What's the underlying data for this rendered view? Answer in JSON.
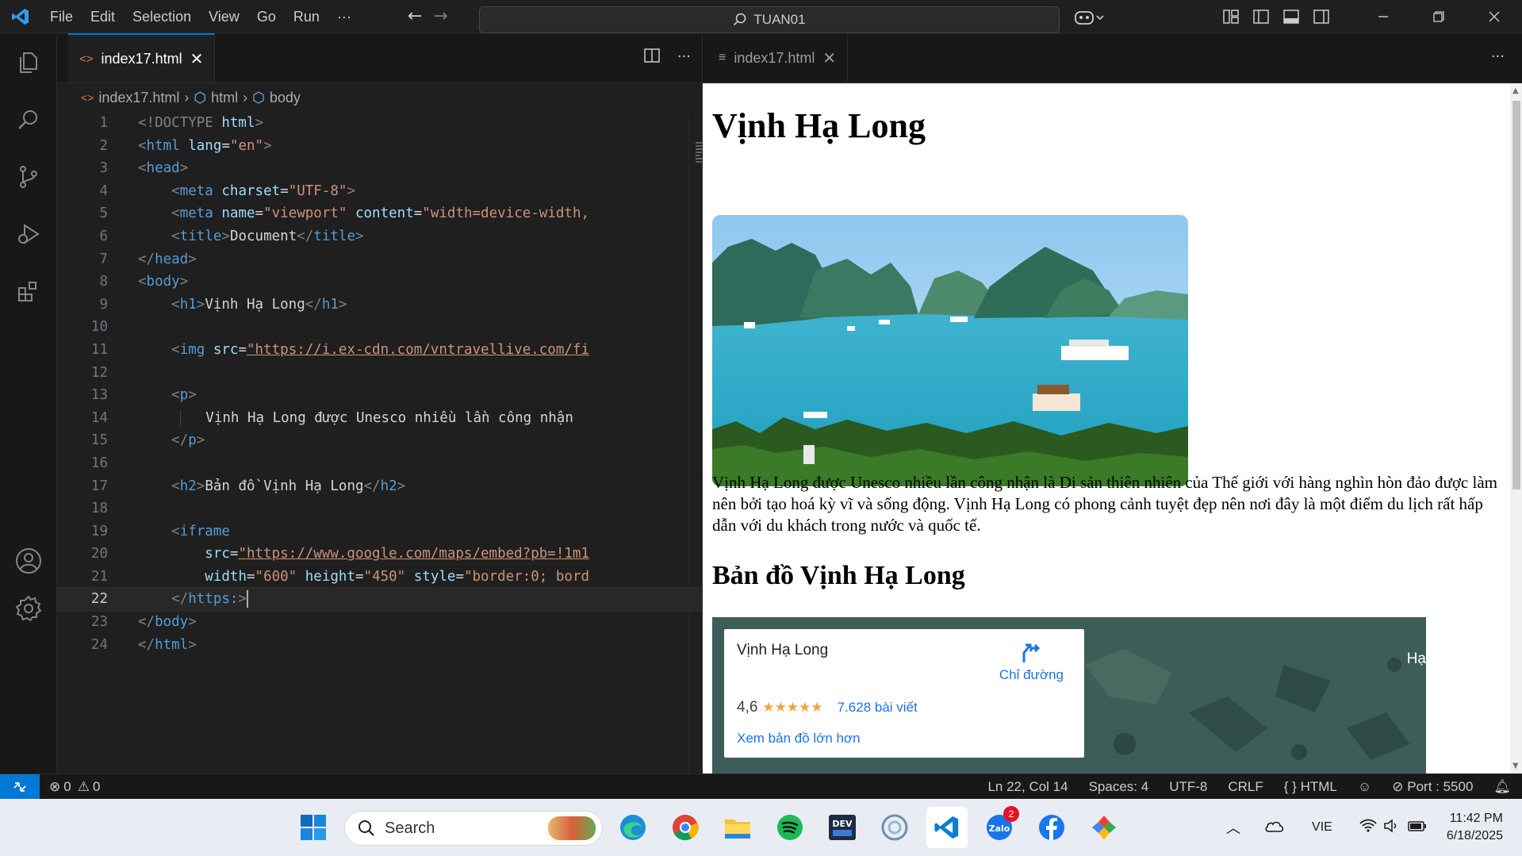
{
  "menu": [
    "File",
    "Edit",
    "Selection",
    "View",
    "Go",
    "Run",
    "···"
  ],
  "search": {
    "text": "TUAN01"
  },
  "editor": {
    "tab_label": "index17.html",
    "breadcrumb": [
      "index17.html",
      "html",
      "body"
    ]
  },
  "code_lines": [
    {
      "n": "1"
    },
    {
      "n": "2"
    },
    {
      "n": "3"
    },
    {
      "n": "4"
    },
    {
      "n": "5"
    },
    {
      "n": "6"
    },
    {
      "n": "7"
    },
    {
      "n": "8"
    },
    {
      "n": "9"
    },
    {
      "n": "10"
    },
    {
      "n": "11"
    },
    {
      "n": "12"
    },
    {
      "n": "13"
    },
    {
      "n": "14"
    },
    {
      "n": "15"
    },
    {
      "n": "16"
    },
    {
      "n": "17"
    },
    {
      "n": "18"
    },
    {
      "n": "19"
    },
    {
      "n": "20"
    },
    {
      "n": "21"
    },
    {
      "n": "22"
    },
    {
      "n": "23"
    },
    {
      "n": "24"
    }
  ],
  "code": {
    "l1a": "<!DOCTYPE",
    "l1b": " html",
    "l1c": ">",
    "l2a": "<",
    "l2b": "html",
    "l2c": " lang",
    "l2d": "=",
    "l2e": "\"en\"",
    "l2f": ">",
    "l3": "head",
    "l4a": "meta",
    "l4b": " charset",
    "l4c": "\"UTF-8\"",
    "l5a": "meta",
    "l5b": " name",
    "l5c": "\"viewport\"",
    "l5d": " content",
    "l5e": "\"width=device-width,",
    "l6a": "title",
    "l6b": "Document",
    "l6c": "title",
    "l7": "head",
    "l8": "body",
    "l9a": "h1",
    "l9b": "Vịnh Hạ Long",
    "l9c": "h1",
    "l11a": "img",
    "l11b": " src",
    "l11c": "\"https://i.ex-cdn.com/vntravellive.com/fi",
    "l13": "p",
    "l14": "Vịnh Hạ Long được Unesco nhiều lần công nhận",
    "l15": "p",
    "l17a": "h2",
    "l17b": "Bản đồ Vịnh Hạ Long",
    "l17c": "h2",
    "l19": "iframe",
    "l20a": "src",
    "l20b": "\"https://www.google.com/maps/embed?pb=!1m1",
    "l21a": "width",
    "l21b": "\"600\"",
    "l21c": " height",
    "l21d": "\"450\"",
    "l21e": " style",
    "l21f": "\"border:0; bord",
    "l22": "https:",
    "l23": "body",
    "l24": "html"
  },
  "preview": {
    "tab_label": "index17.html",
    "h1": "Vịnh Hạ Long",
    "paragraph": "Vịnh Hạ Long được Unesco nhiều lần công nhận là Di sản thiên nhiên của Thế giới với hàng nghìn hòn đảo được làm nên bởi tạo hoá kỳ vĩ và sống động. Vịnh Hạ Long có phong cảnh tuyệt đẹp nên nơi đây là một điểm du lịch rất hấp dẫn với du khách trong nước và quốc tế.",
    "h2": "Bản đồ Vịnh Hạ Long",
    "map": {
      "place": "Vịnh Hạ Long",
      "directions": "Chỉ đường",
      "rating": "4,6",
      "stars": "★★★★★",
      "reviews": "7.628 bài viết",
      "larger_map": "Xem bản đồ lớn hơn",
      "edge_label": "Hạ"
    }
  },
  "status": {
    "errors": "0",
    "warnings": "0",
    "position": "Ln 22, Col 14",
    "spaces": "Spaces: 4",
    "encoding": "UTF-8",
    "eol": "CRLF",
    "language": "HTML",
    "port": "Port : 5500"
  },
  "taskbar": {
    "search": "Search",
    "lang": "VIE",
    "time": "11:42 PM",
    "date": "6/18/2025",
    "zalo_badge": "2"
  },
  "colors": {
    "accent": "#0078d4",
    "tag": "#569cd6",
    "attr": "#9cdcfe",
    "string": "#ce9178"
  }
}
